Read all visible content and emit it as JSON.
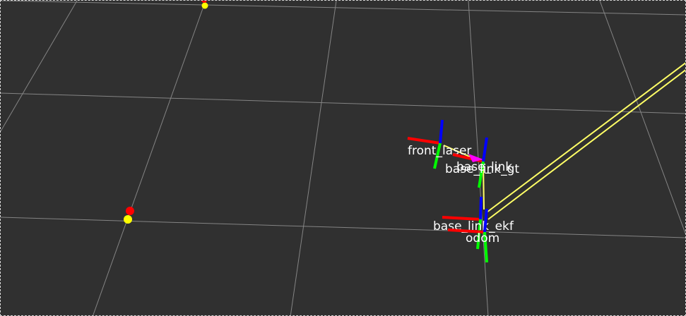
{
  "viewport": {
    "background_color": "#303030",
    "grid_color": "#a0a0a0",
    "selection_border_color": "#d8d8d8"
  },
  "axis_colors": {
    "x": "#ff0000",
    "y": "#00ff00",
    "z": "#0000ff",
    "arrow": "#ff00ff",
    "link": "#ffff66"
  },
  "tf_frames": [
    {
      "id": "front_laser",
      "label": "front_laser"
    },
    {
      "id": "base_link",
      "label": "base_link"
    },
    {
      "id": "base_link_gt",
      "label": "base_link_gt"
    },
    {
      "id": "base_link_ekf",
      "label": "base_link_ekf"
    },
    {
      "id": "odom",
      "label": "odom"
    }
  ],
  "markers": {
    "marker_1_colors": [
      "#ffff00",
      "#ff0000"
    ],
    "marker_2_colors": [
      "#ff0000",
      "#ffff00"
    ]
  }
}
